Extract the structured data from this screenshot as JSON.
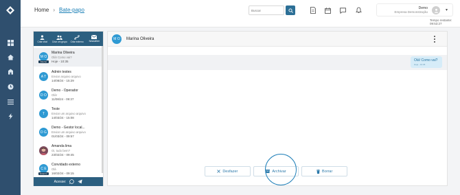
{
  "breadcrumb": {
    "home": "Home",
    "current": "Bate-papo"
  },
  "search": {
    "placeholder": "Buscar"
  },
  "header_icons": [
    "document-icon",
    "calendar-icon",
    "chat-bubble-icon",
    "bell-icon"
  ],
  "user": {
    "name": "Demo",
    "company": "Empresa Demonstração",
    "session_label": "Tempo restante: 09:53:27"
  },
  "rail_icons": [
    "logo-icon",
    "dashboard-icon",
    "home-icon",
    "building-icon",
    "clock-icon",
    "list-icon",
    "bolt-icon"
  ],
  "toolbar": [
    {
      "label": "Criar chat",
      "icon": "user-icon"
    },
    {
      "label": "Criar um grupo",
      "icon": "group-icon"
    },
    {
      "label": "Criar externo",
      "icon": "link-icon"
    },
    {
      "label": "Newsletter",
      "icon": "mail-icon"
    }
  ],
  "conversations": [
    {
      "initials": "M O",
      "name": "Marina Oliveira",
      "preview": "Olá! Como vai?",
      "date": "Hoje - 10:35",
      "badge": "Interno",
      "avatar_color": "#2f9ad3",
      "selected": true
    },
    {
      "initials": "A T",
      "name": "Admin testes",
      "preview": "Enviar arquivo arquivo",
      "date": "14/08/24 - 15:29",
      "badge": "",
      "avatar_color": "#2f9ad3",
      "selected": false
    },
    {
      "initials": "D O",
      "name": "Demo - Operador",
      "preview": "Olá!",
      "date": "11/08/24 - 09:37",
      "badge": "",
      "avatar_color": "#2f9ad3",
      "selected": false
    },
    {
      "initials": "T",
      "name": "Teste",
      "preview": "Enviar um arquivo arquivo",
      "date": "14/03/24 - 15:08",
      "badge": "",
      "avatar_color": "#2f9ad3",
      "selected": false
    },
    {
      "initials": "D G",
      "name": "Demo - Gestor local...",
      "preview": "Enviar um arquivo arquivo",
      "date": "01/03/24 - 09:57",
      "badge": "",
      "avatar_color": "#2f9ad3",
      "selected": false
    },
    {
      "initials": "",
      "name": "Amanda lima",
      "preview": "Oi, tudo bem?",
      "date": "23/02/24 - 09:45",
      "badge": "",
      "avatar_color": "#7d4a5b",
      "selected": false
    },
    {
      "initials": "C E",
      "name": "Convidado externo",
      "preview": "Olá",
      "date": "16/02/24 - 09:15",
      "badge": "Externo",
      "avatar_color": "#2f9ad3",
      "selected": false
    }
  ],
  "list_footer": {
    "label": "Acesse:",
    "icons": [
      "whatsapp-icon",
      "telegram-icon"
    ]
  },
  "chat": {
    "initials": "M O",
    "name": "Marina Oliveira",
    "message": {
      "text": "Olá! Como vai?",
      "meta": "Hoje - 10:35"
    }
  },
  "actions": [
    {
      "label": "Desfazer",
      "icon": "x-icon"
    },
    {
      "label": "Archivar",
      "icon": "archive-icon"
    },
    {
      "label": "Borrar",
      "icon": "trash-icon"
    }
  ]
}
